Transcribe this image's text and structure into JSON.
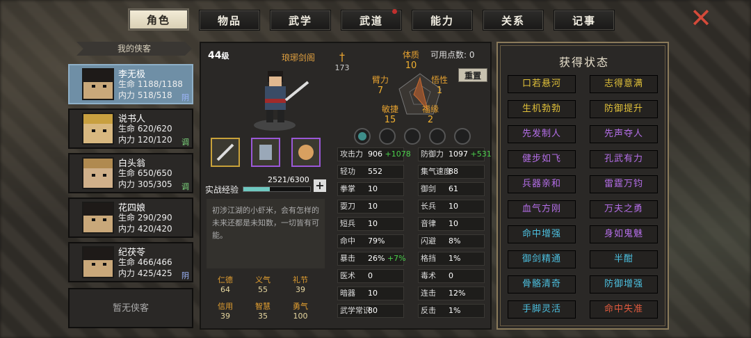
{
  "tabs": [
    {
      "label": "角色"
    },
    {
      "label": "物品"
    },
    {
      "label": "武学"
    },
    {
      "label": "武道"
    },
    {
      "label": "能力"
    },
    {
      "label": "关系"
    },
    {
      "label": "记事"
    }
  ],
  "party": {
    "header": "我的侠客",
    "empty": "暂无侠客",
    "members": [
      {
        "name": "李无极",
        "hp": "生命 1188/1188",
        "mp": "内力 518/518",
        "tag": "阴"
      },
      {
        "name": "说书人",
        "hp": "生命 620/620",
        "mp": "内力 120/120",
        "tag": "调"
      },
      {
        "name": "白头翁",
        "hp": "生命 650/650",
        "mp": "内力 305/305",
        "tag": "调"
      },
      {
        "name": "花四娘",
        "hp": "生命 290/290",
        "mp": "内力 420/420",
        "tag": ""
      },
      {
        "name": "纪茯苓",
        "hp": "生命 466/466",
        "mp": "内力 425/425",
        "tag": "阴"
      }
    ]
  },
  "char": {
    "level": "44",
    "level_unit": "级",
    "sect": "琅琊剑阁",
    "strength": "173",
    "points_label": "可用点数: 0",
    "reset": "重置",
    "attrs": {
      "tizhi": "体质",
      "tizhi_v": "10",
      "bili": "臂力",
      "bili_v": "7",
      "wuxing": "悟性",
      "wuxing_v": "1",
      "minjie": "敏捷",
      "minjie_v": "15",
      "fuyuan": "福缘",
      "fuyuan_v": "2"
    },
    "exp_label": "实战经验",
    "exp_text": "2521/6300",
    "exp_fraction": 0.4,
    "plus": "+",
    "desc": "初涉江湖的小虾米，会有怎样的未来还都是未知数，一切皆有可能。",
    "virtues": [
      {
        "k": "仁德",
        "v": "64"
      },
      {
        "k": "义气",
        "v": "55"
      },
      {
        "k": "礼节",
        "v": "39"
      },
      {
        "k": "信用",
        "v": "39"
      },
      {
        "k": "智慧",
        "v": "35"
      },
      {
        "k": "勇气",
        "v": "100"
      }
    ],
    "stats": [
      {
        "k": "攻击力",
        "v": "906",
        "b": "+1078"
      },
      {
        "k": "防御力",
        "v": "1097",
        "b": "+531"
      },
      {
        "k": "轻功",
        "v": "552",
        "b": ""
      },
      {
        "k": "集气速度",
        "v": "88",
        "b": ""
      },
      {
        "k": "拳掌",
        "v": "10",
        "b": ""
      },
      {
        "k": "御剑",
        "v": "61",
        "b": ""
      },
      {
        "k": "耍刀",
        "v": "10",
        "b": ""
      },
      {
        "k": "长兵",
        "v": "10",
        "b": ""
      },
      {
        "k": "短兵",
        "v": "10",
        "b": ""
      },
      {
        "k": "音律",
        "v": "10",
        "b": ""
      },
      {
        "k": "命中",
        "v": "79%",
        "b": ""
      },
      {
        "k": "闪避",
        "v": "8%",
        "b": ""
      },
      {
        "k": "暴击",
        "v": "26%",
        "b": "+7%"
      },
      {
        "k": "格挡",
        "v": "1%",
        "b": ""
      },
      {
        "k": "医术",
        "v": "0",
        "b": ""
      },
      {
        "k": "毒术",
        "v": "0",
        "b": ""
      },
      {
        "k": "暗器",
        "v": "10",
        "b": ""
      },
      {
        "k": "连击",
        "v": "12%",
        "b": ""
      },
      {
        "k": "武学常识",
        "v": "80",
        "b": ""
      },
      {
        "k": "反击",
        "v": "1%",
        "b": ""
      }
    ]
  },
  "status": {
    "title": "获得状态",
    "buttons": [
      {
        "label": "口若悬河",
        "color": "#e2c23a"
      },
      {
        "label": "志得意满",
        "color": "#e2c23a"
      },
      {
        "label": "生机勃勃",
        "color": "#e2c23a"
      },
      {
        "label": "防御提升",
        "color": "#e2c23a"
      },
      {
        "label": "先发制人",
        "color": "#b46ee8"
      },
      {
        "label": "先声夺人",
        "color": "#b46ee8"
      },
      {
        "label": "健步如飞",
        "color": "#b46ee8"
      },
      {
        "label": "孔武有力",
        "color": "#b46ee8"
      },
      {
        "label": "兵器亲和",
        "color": "#b46ee8"
      },
      {
        "label": "雷霆万钧",
        "color": "#b46ee8"
      },
      {
        "label": "血气方刚",
        "color": "#b46ee8"
      },
      {
        "label": "万夫之勇",
        "color": "#b46ee8"
      },
      {
        "label": "命中增强",
        "color": "#4cc0e0"
      },
      {
        "label": "身如鬼魅",
        "color": "#b46ee8"
      },
      {
        "label": "御剑精通",
        "color": "#4cc0e0"
      },
      {
        "label": "半酣",
        "color": "#4cc0e0"
      },
      {
        "label": "骨骼清奇",
        "color": "#4cc0e0"
      },
      {
        "label": "防御增强",
        "color": "#4cc0e0"
      },
      {
        "label": "手脚灵活",
        "color": "#4cc0e0"
      },
      {
        "label": "命中失准",
        "color": "#e05a3e"
      }
    ]
  }
}
